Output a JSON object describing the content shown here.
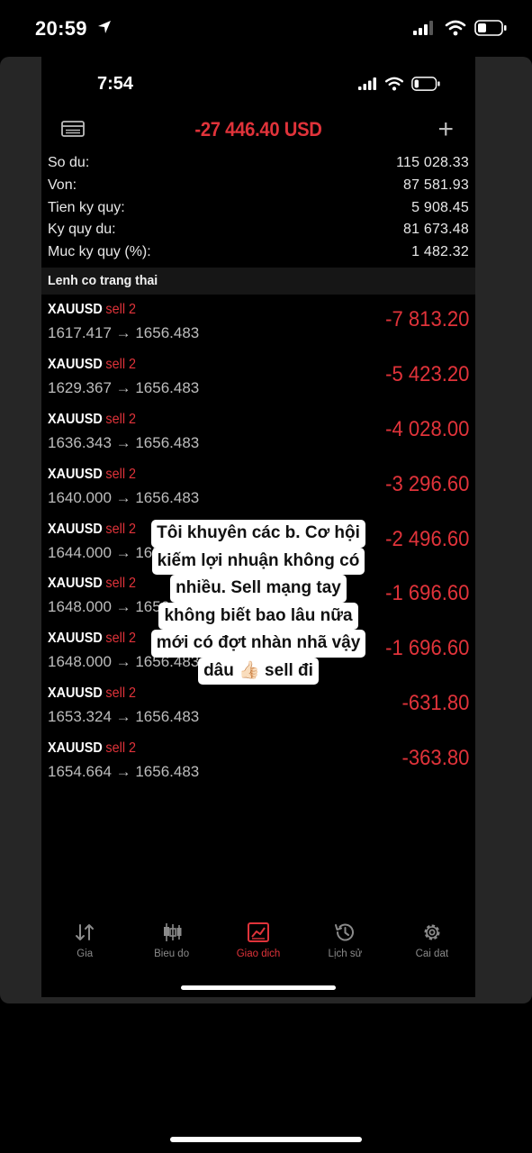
{
  "outer_status": {
    "time": "20:59"
  },
  "inner_status": {
    "time": "7:54"
  },
  "header": {
    "total": "-27 446.40 USD"
  },
  "summary": [
    {
      "label": "So du:",
      "value": "115 028.33"
    },
    {
      "label": "Von:",
      "value": "87 581.93"
    },
    {
      "label": "Tien ky quy:",
      "value": "5 908.45"
    },
    {
      "label": "Ky quy du:",
      "value": "81 673.48"
    },
    {
      "label": "Muc ky quy (%):",
      "value": "1 482.32"
    }
  ],
  "section_title": "Lenh co trang thai",
  "orders": [
    {
      "symbol": "XAUUSD",
      "side": "sell 2",
      "prices": "1617.417 → 1656.483",
      "pl": "-7 813.20"
    },
    {
      "symbol": "XAUUSD",
      "side": "sell 2",
      "prices": "1629.367 → 1656.483",
      "pl": "-5 423.20"
    },
    {
      "symbol": "XAUUSD",
      "side": "sell 2",
      "prices": "1636.343 → 1656.483",
      "pl": "-4 028.00"
    },
    {
      "symbol": "XAUUSD",
      "side": "sell 2",
      "prices": "1640.000 → 1656.483",
      "pl": "-3 296.60"
    },
    {
      "symbol": "XAUUSD",
      "side": "sell 2",
      "prices": "1644.000 → 1656.483",
      "pl": "-2 496.60"
    },
    {
      "symbol": "XAUUSD",
      "side": "sell 2",
      "prices": "1648.000 → 1656.483",
      "pl": "-1 696.60"
    },
    {
      "symbol": "XAUUSD",
      "side": "sell 2",
      "prices": "1648.000 → 1656.483",
      "pl": "-1 696.60"
    },
    {
      "symbol": "XAUUSD",
      "side": "sell 2",
      "prices": "1653.324 → 1656.483",
      "pl": "-631.80"
    },
    {
      "symbol": "XAUUSD",
      "side": "sell 2",
      "prices": "1654.664 → 1656.483",
      "pl": "-363.80"
    }
  ],
  "overlay_text": [
    "Tôi khuyên các b. Cơ hội",
    "kiếm lợi nhuận không có",
    "nhiều. Sell mạng tay",
    "không biết bao lâu nữa",
    "mới có đợt nhàn nhã vậy",
    "dâu 👍🏻 sell đi"
  ],
  "tabs": [
    {
      "label": "Gia",
      "icon": "arrows-updown-icon",
      "active": false
    },
    {
      "label": "Bieu do",
      "icon": "candlestick-icon",
      "active": false
    },
    {
      "label": "Giao dich",
      "icon": "trade-chart-icon",
      "active": true
    },
    {
      "label": "Lịch sử",
      "icon": "history-icon",
      "active": false
    },
    {
      "label": "Cai dat",
      "icon": "gear-icon",
      "active": false
    }
  ],
  "colors": {
    "loss": "#e0333a",
    "inactive_tab": "#8a8a8a",
    "frame": "#262626"
  }
}
